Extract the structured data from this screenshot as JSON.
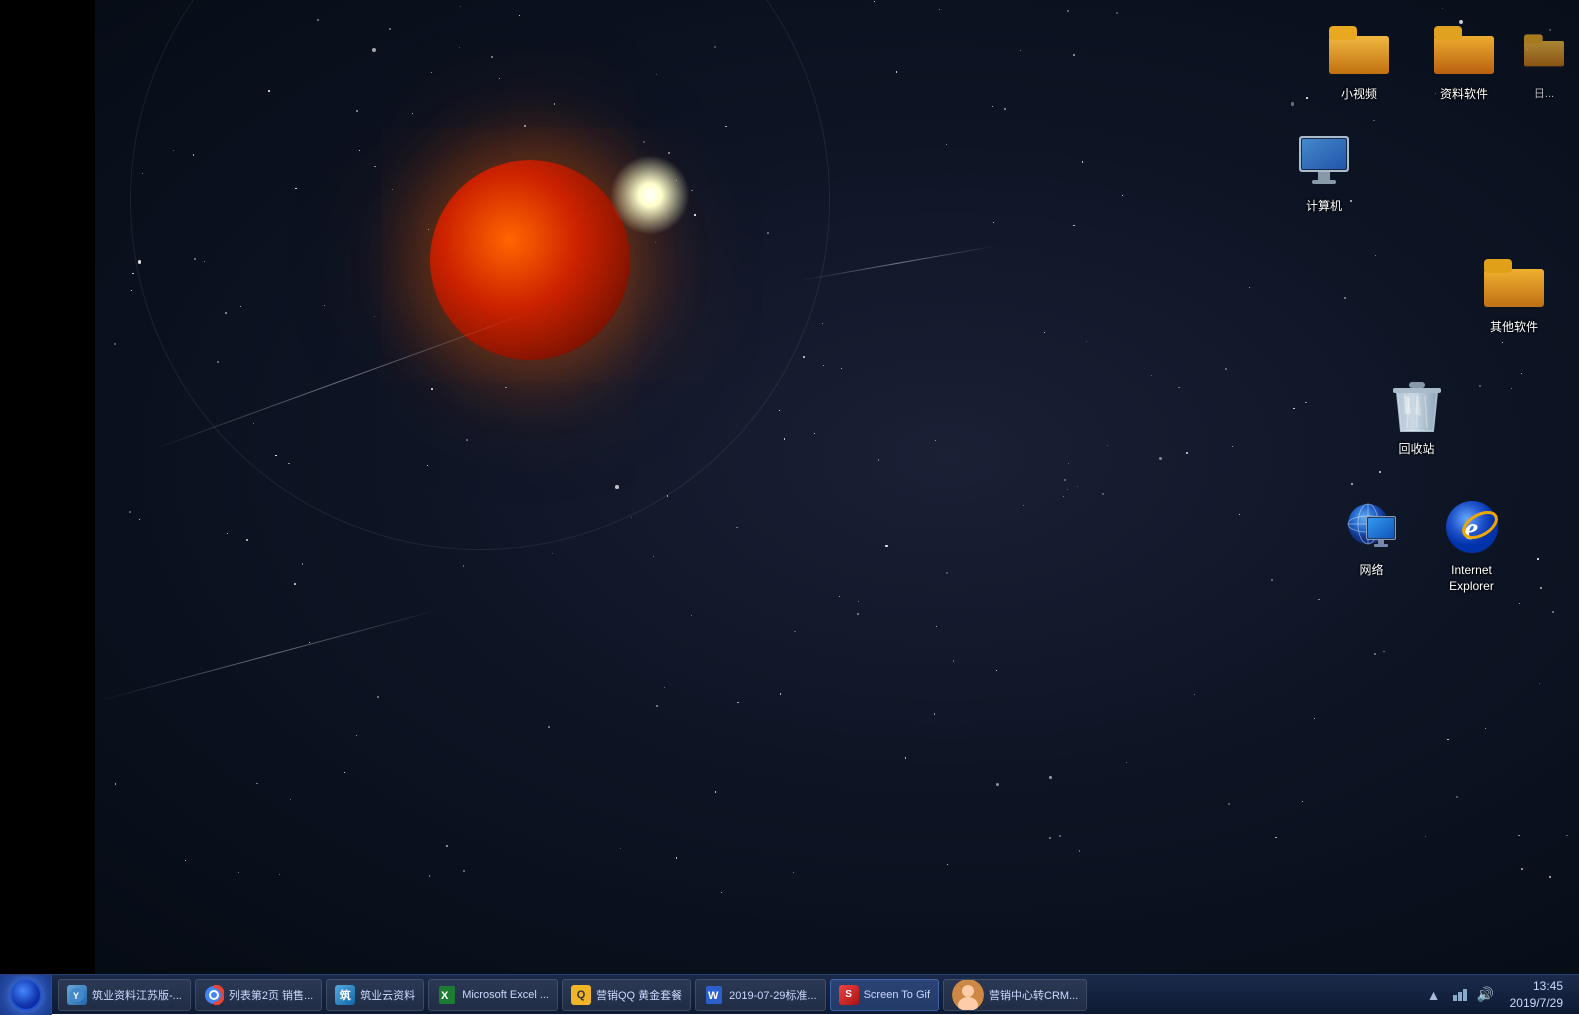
{
  "desktop": {
    "bg_color": "#080d18",
    "left_bar_color": "#000000"
  },
  "icons": {
    "top_row": [
      {
        "id": "xiao-shipin",
        "label": "小视频",
        "type": "folder"
      },
      {
        "id": "ziliao-ruanjian",
        "label": "资料软件",
        "type": "folder"
      }
    ],
    "edge_top_right": [
      {
        "id": "ri-icon",
        "label": "日...",
        "type": "folder"
      }
    ],
    "mid_row": [
      {
        "id": "computer",
        "label": "计算机",
        "type": "computer"
      }
    ],
    "mid2_row": [
      {
        "id": "qita-ruanjian",
        "label": "其他软件",
        "type": "folder"
      }
    ],
    "bottom_row": [
      {
        "id": "recycle",
        "label": "回收站",
        "type": "recycle"
      }
    ],
    "net_row": [
      {
        "id": "network",
        "label": "网络",
        "type": "network"
      },
      {
        "id": "ie",
        "label": "Internet\nExplorer",
        "type": "ie"
      }
    ]
  },
  "taskbar": {
    "items": [
      {
        "id": "yiye-jiangsu",
        "label": "筑业资料江苏版-...",
        "icon_color": "#4a90d9",
        "icon_char": "Y"
      },
      {
        "id": "liebiao-xiaoshou",
        "label": "列表第2页 销售...",
        "icon_color": "#e8a820",
        "icon_char": "C"
      },
      {
        "id": "yiye-yunziliao",
        "label": "筑业云资料",
        "icon_color": "#4a90d9",
        "icon_char": "Y"
      },
      {
        "id": "excel",
        "label": "Microsoft Excel ...",
        "icon_color": "#1e7b34",
        "icon_char": "X"
      },
      {
        "id": "yingxiao-qq",
        "label": "营销QQ 黄金套餐",
        "icon_color": "#f0b429",
        "icon_char": "Q"
      },
      {
        "id": "word",
        "label": "2019-07-29标准...",
        "icon_color": "#2b5fcc",
        "icon_char": "W"
      },
      {
        "id": "screen-to-gif",
        "label": "Screen To Gif",
        "icon_color": "#cc3333",
        "icon_char": "S",
        "active": true
      },
      {
        "id": "yingxiao-crm",
        "label": "营销中心转CRM...",
        "icon_color": "#cc6600",
        "icon_char": "M"
      }
    ],
    "clock": "13:45\n2019/7/29"
  }
}
